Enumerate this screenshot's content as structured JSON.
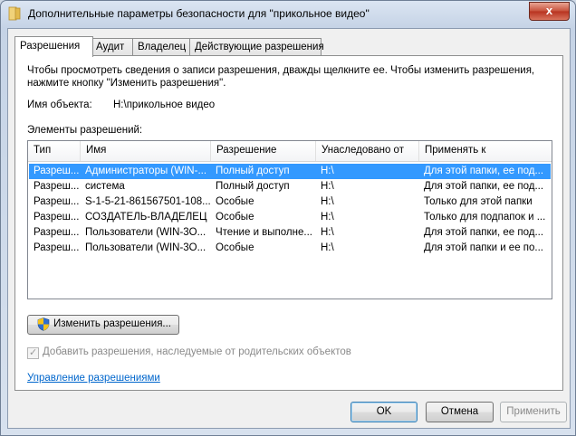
{
  "window": {
    "title": "Дополнительные параметры безопасности  для \"прикольное видео\"",
    "close_label": "x"
  },
  "tabs": [
    {
      "label": "Разрешения",
      "active": true
    },
    {
      "label": "Аудит",
      "active": false
    },
    {
      "label": "Владелец",
      "active": false
    },
    {
      "label": "Действующие разрешения",
      "active": false
    }
  ],
  "panel": {
    "description": "Чтобы просмотреть сведения о записи разрешения, дважды щелкните ее. Чтобы изменить разрешения, нажмите кнопку \"Изменить разрешения\".",
    "object_name_label": "Имя объекта:",
    "object_name_value": "H:\\прикольное видео",
    "elements_label": "Элементы разрешений:"
  },
  "table": {
    "columns": [
      "Тип",
      "Имя",
      "Разрешение",
      "Унаследовано от",
      "Применять к"
    ],
    "rows": [
      [
        "Разреш...",
        "Администраторы (WIN-...",
        "Полный доступ",
        "H:\\",
        "Для этой папки, ее под..."
      ],
      [
        "Разреш...",
        "система",
        "Полный доступ",
        "H:\\",
        "Для этой папки, ее под..."
      ],
      [
        "Разреш...",
        "S-1-5-21-861567501-108...",
        "Особые",
        "H:\\",
        "Только для этой папки"
      ],
      [
        "Разреш...",
        "СОЗДАТЕЛЬ-ВЛАДЕЛЕЦ",
        "Особые",
        "H:\\",
        "Только для подпапок и ..."
      ],
      [
        "Разреш...",
        "Пользователи (WIN-3O...",
        "Чтение и выполне...",
        "H:\\",
        "Для этой папки, ее под..."
      ],
      [
        "Разреш...",
        "Пользователи (WIN-3O...",
        "Особые",
        "H:\\",
        "Для этой папки и ее по..."
      ]
    ],
    "selected_row": 0
  },
  "change_permissions_label": "Изменить разрешения...",
  "inherit_checkbox": {
    "label": "Добавить разрешения, наследуемые от родительских объектов",
    "checked": true
  },
  "manage_link": "Управление разрешениями",
  "footer": {
    "ok_label": "OK",
    "cancel_label": "Отмена",
    "apply_label": "Применить"
  },
  "colors": {
    "selection": "#3399ff",
    "link": "#0066cc"
  }
}
